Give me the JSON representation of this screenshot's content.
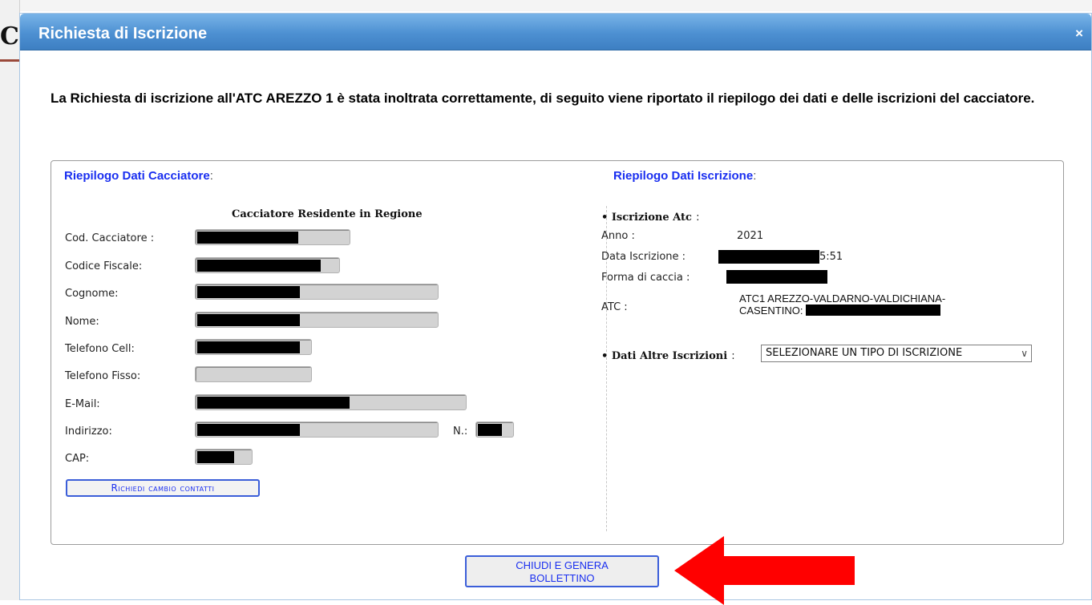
{
  "dialog": {
    "title": "Richiesta di Iscrizione",
    "close_label": "×",
    "intro": "La Richiesta di iscrizione all'ATC AREZZO 1 è stata inoltrata correttamente, di seguito viene riportato il riepilogo dei dati e delle iscrizioni del cacciatore."
  },
  "hunter": {
    "section_title": "Riepilogo Dati Cacciatore",
    "colon": ":",
    "subtitle": "Cacciatore Residente in Regione",
    "fields": {
      "cod_cacciatore": "Cod. Cacciatore :",
      "codice_fiscale": "Codice Fiscale:",
      "cognome": "Cognome:",
      "nome": "Nome:",
      "telefono_cell": "Telefono Cell:",
      "telefono_fisso": "Telefono Fisso:",
      "email": "E-Mail:",
      "indirizzo": "Indirizzo:",
      "numero": "N.:",
      "cap": "CAP:"
    },
    "change_contacts_button": "Richiedi cambio contatti"
  },
  "enrollment": {
    "section_title": "Riepilogo Dati Iscrizione",
    "colon": ":",
    "atc_header": "• Iscrizione Atc",
    "atc_header_colon": ":",
    "anno_label": "Anno :",
    "anno_value": "2021",
    "data_label": "Data Iscrizione :",
    "data_value_visible": "5:51",
    "forma_label": "Forma di caccia :",
    "atc_label": "ATC :",
    "atc_value_line1": "ATC1 AREZZO-VALDARNO-VALDICHIANA-",
    "atc_value_line2": "CASENTINO:",
    "altre_label": "• Dati Altre Iscrizioni",
    "altre_colon": ":",
    "altre_select_value": "SELEZIONARE UN TIPO DI ISCRIZIONE"
  },
  "footer": {
    "close_generate_button_line1": "CHIUDI E GENERA",
    "close_generate_button_line2": "BOLLETTINO"
  },
  "colors": {
    "title_bar": "#4d90d2",
    "section_title": "#1a2ff0",
    "annotation_arrow": "#ff0000"
  },
  "icons": {
    "close": "close-icon",
    "select_arrow": "chevron-down-icon",
    "annotation": "arrow-left-icon"
  }
}
